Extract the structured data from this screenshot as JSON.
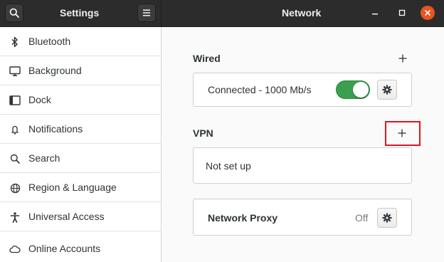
{
  "header": {
    "sidebar_title": "Settings",
    "main_title": "Network",
    "search_icon": "search-icon",
    "menu_icon": "hamburger-menu-icon",
    "controls": [
      "minimize-icon",
      "maximize-icon",
      "close-icon"
    ]
  },
  "sidebar": {
    "items": [
      {
        "label": "Bluetooth",
        "icon": "bluetooth-icon"
      },
      {
        "label": "Background",
        "icon": "monitor-icon"
      },
      {
        "label": "Dock",
        "icon": "dock-icon"
      },
      {
        "label": "Notifications",
        "icon": "bell-icon"
      },
      {
        "label": "Search",
        "icon": "search-icon"
      },
      {
        "label": "Region & Language",
        "icon": "globe-icon"
      },
      {
        "label": "Universal Access",
        "icon": "accessibility-icon"
      },
      {
        "label": "Online Accounts",
        "icon": "cloud-icon"
      }
    ]
  },
  "wired": {
    "title": "Wired",
    "status": "Connected - 1000 Mb/s",
    "toggle_on": true
  },
  "vpn": {
    "title": "VPN",
    "status": "Not set up"
  },
  "proxy": {
    "label": "Network Proxy",
    "state": "Off"
  },
  "colors": {
    "headerbar": "#2c2c2c",
    "accent_close": "#e95420",
    "toggle_on": "#3a9f4f",
    "highlight": "#e0141e"
  }
}
